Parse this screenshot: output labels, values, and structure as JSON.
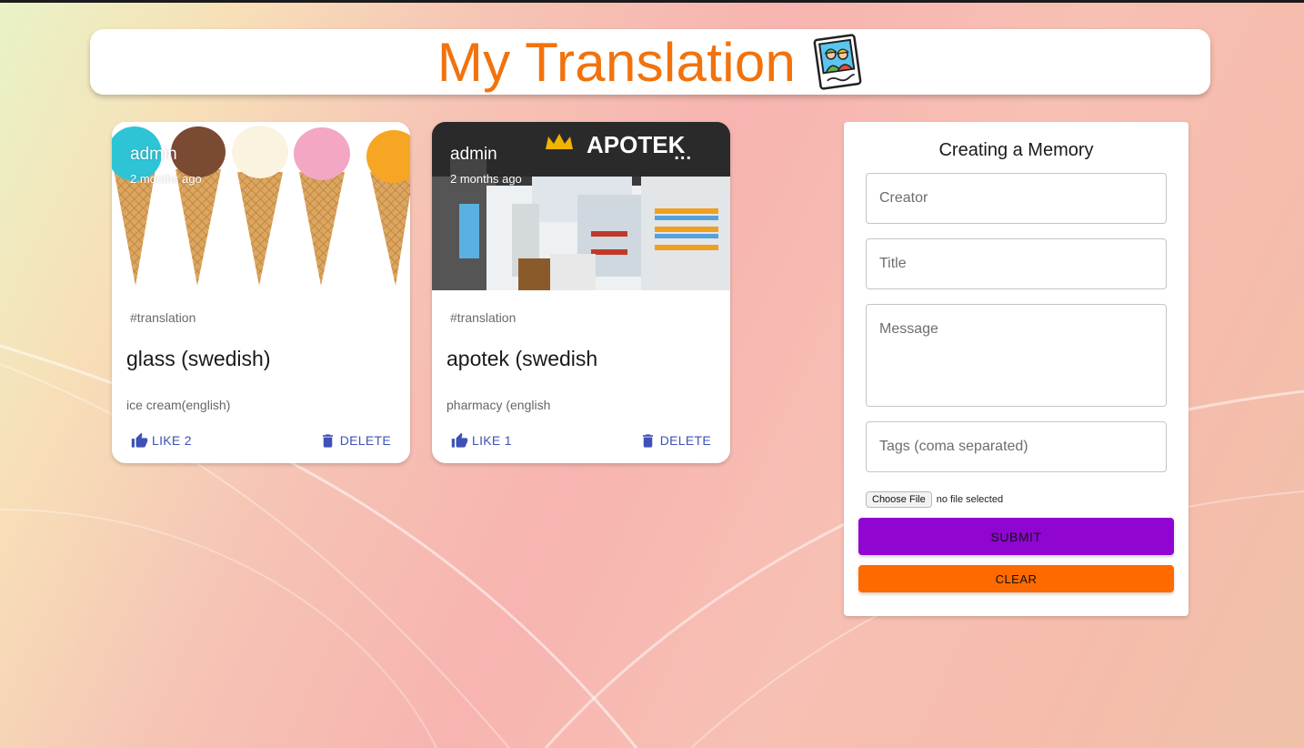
{
  "app": {
    "title": "My Translation",
    "logo_icon": "memories-photo-icon"
  },
  "theme": {
    "title_color": "#f2720c",
    "action_color": "#3f51b5",
    "submit_color": "#9005d2",
    "clear_color": "#ff6a00"
  },
  "posts": [
    {
      "creator": "admin",
      "time": "2 months ago",
      "image": "ice-cream-cones-image",
      "tags": "#translation",
      "title": "glass (swedish)",
      "message": "ice cream(english)",
      "like_label": "LIKE 2",
      "likes": 2,
      "delete_label": "DELETE"
    },
    {
      "creator": "admin",
      "time": "2 months ago",
      "image": "apotek-pharmacy-store-image",
      "store_sign": "APOTEK",
      "more_label": "...",
      "tags": "#translation",
      "title": "apotek (swedish",
      "message": "pharmacy (english",
      "like_label": "LIKE 1",
      "likes": 1,
      "delete_label": "DELETE"
    }
  ],
  "form": {
    "title": "Creating a Memory",
    "creator_placeholder": "Creator",
    "title_placeholder": "Title",
    "message_placeholder": "Message",
    "tags_placeholder": "Tags (coma separated)",
    "file_button": "Choose File",
    "file_status": "no file selected",
    "submit_label": "SUBMIT",
    "clear_label": "CLEAR"
  }
}
